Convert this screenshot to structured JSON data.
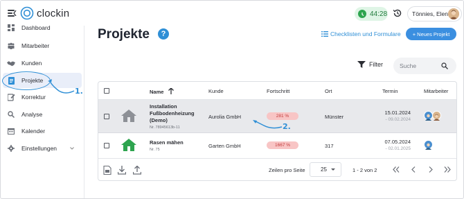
{
  "app": {
    "logo_text": "clockin"
  },
  "topbar": {
    "timer": "44:28",
    "user_name": "Tönnies, Elena"
  },
  "sidebar": {
    "items": [
      {
        "label": "Dashboard",
        "icon": "dashboard-icon"
      },
      {
        "label": "Mitarbeiter",
        "icon": "people-icon"
      },
      {
        "label": "Kunden",
        "icon": "handshake-icon"
      },
      {
        "label": "Projekte",
        "icon": "document-icon",
        "active": true
      },
      {
        "label": "Korrektur",
        "icon": "edit-icon"
      },
      {
        "label": "Analyse",
        "icon": "search-icon"
      },
      {
        "label": "Kalender",
        "icon": "calendar-icon"
      },
      {
        "label": "Einstellungen",
        "icon": "gear-icon"
      }
    ]
  },
  "annotations": {
    "step1": "1.",
    "step2": "2."
  },
  "main": {
    "title": "Projekte",
    "help": "?",
    "checklist_link": "Checklisten und Formulare",
    "new_project": "+ Neues Projekt",
    "filter_label": "Filter",
    "search_placeholder": "Suche"
  },
  "table": {
    "headers": {
      "name": "Name",
      "kunde": "Kunde",
      "fortschritt": "Fortschritt",
      "ort": "Ort",
      "termin": "Termin",
      "mitarbeiter": "Mitarbeiter"
    },
    "rows": [
      {
        "name_line1": "Installation",
        "name_line2": "Fußbodenheizung",
        "name_line3": "(Demo)",
        "nr": "Nr. 78945613b-11",
        "kunde": "Aurolia GmbH",
        "fortschritt": "281 %",
        "ort": "Münster",
        "termin_start": "15.01.2024",
        "termin_end": "- 09.02.2024"
      },
      {
        "name_line1": "Rasen mähen",
        "nr": "Nr. 75",
        "kunde": "Garten GmbH",
        "fortschritt": "1667 %",
        "ort": "317",
        "termin_start": "07.05.2024",
        "termin_end": "- 02.01.2025"
      }
    ],
    "footer": {
      "rows_per_page_label": "Zeilen pro Seite",
      "rows_per_page_value": "25",
      "range": "1 - 2 von 2"
    }
  },
  "colors": {
    "accent": "#3b8fe0",
    "annotation": "#2f8fd6",
    "progress_bg": "#f8c5c5",
    "progress_text": "#c23b3b",
    "timer_bg": "#dff5e6",
    "timer_dot": "#2ea44f"
  }
}
